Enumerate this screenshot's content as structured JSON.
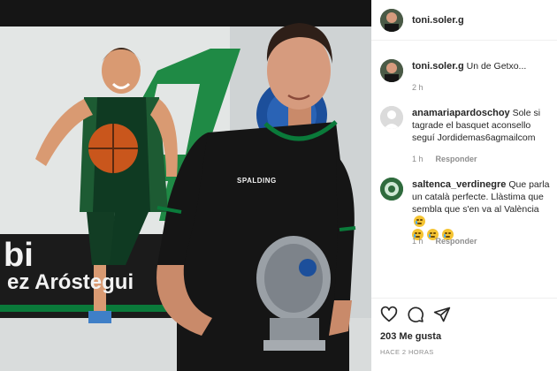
{
  "post": {
    "author": "toni.soler.g",
    "caption_author": "toni.soler.g",
    "caption_text": "Un de Getxo...",
    "caption_time": "2 h",
    "photo": {
      "banner_text_1": "bi",
      "banner_text_2": "ez Aróstegui",
      "shirt_brand": "SPALDING"
    }
  },
  "comments": [
    {
      "username": "anamariapardoschoy",
      "text": "Sole si tagrade el basquet aconsello seguí Jordidemas6agmailcom",
      "time": "1 h",
      "reply_label": "Responder"
    },
    {
      "username": "saltenca_verdinegre",
      "text": "Que parla un català perfecte. Llàstima que sembla que s'en va al València",
      "emoji_label": "crying-face",
      "time": "1 h",
      "reply_label": "Responder"
    }
  ],
  "actions": {
    "likes": "203 Me gusta",
    "ago": "HACE 2 HORAS"
  },
  "colors": {
    "team_green": "#0a7a3a",
    "shirt_black": "#151515",
    "panel_bg": "#ffffff",
    "muted_text": "#8e8e8e"
  }
}
